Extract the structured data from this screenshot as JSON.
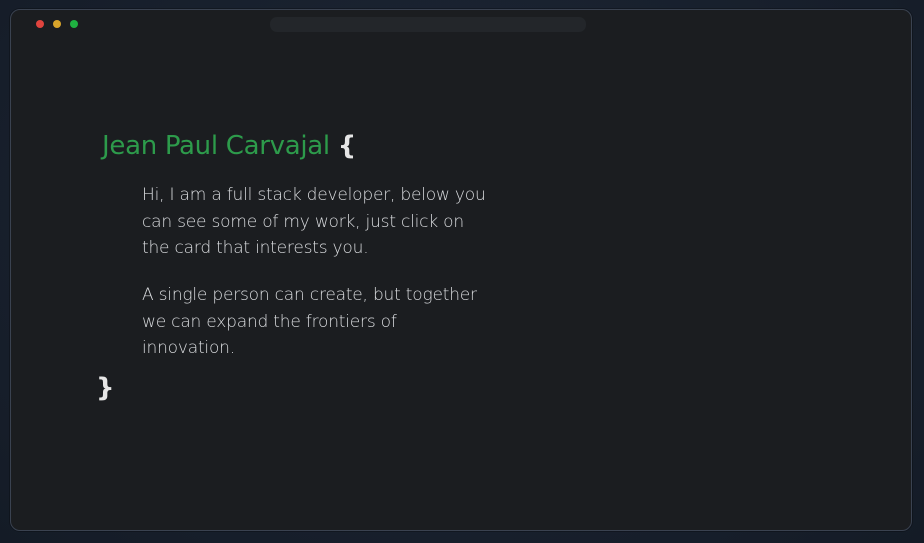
{
  "window": {
    "controls": [
      "close",
      "minimize",
      "maximize"
    ],
    "colors": {
      "close": "#e0443e",
      "minimize": "#d9a52b",
      "maximize": "#1fb141"
    }
  },
  "header": {
    "name": "Jean Paul Carvajal",
    "open_brace": "{",
    "close_brace": "}",
    "name_color": "#2d9b4b"
  },
  "body": {
    "paragraph_1": "Hi, I am a full stack developer, below you\ncan see some of my work, just click on\n the card that interests you.",
    "paragraph_2": "A single person can create, but together\nwe can expand the frontiers of\ninnovation."
  }
}
